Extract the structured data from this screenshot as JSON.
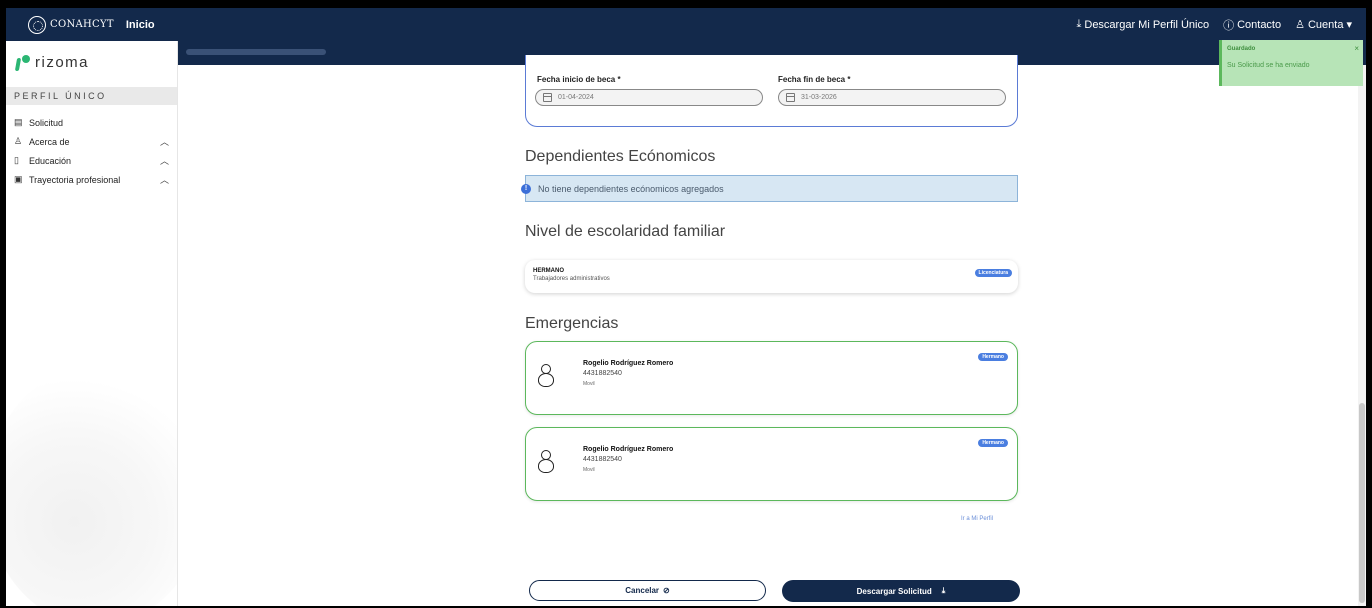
{
  "topbar": {
    "brand": "CONAHCYT",
    "brand_sub": "",
    "home": "Inicio",
    "download_profile": "Descargar Mi Perfil Único",
    "contact": "Contacto",
    "account": "Cuenta",
    "icons": [
      "download-icon",
      "help-circle-icon",
      "user-icon",
      "caret-down-icon"
    ]
  },
  "sidebar": {
    "logo": "rizoma",
    "section_title": "PERFIL ÚNICO",
    "items": [
      {
        "label": "Solicitud",
        "icon": "document-icon",
        "expandable": false
      },
      {
        "label": "Acerca de",
        "icon": "user-icon",
        "expandable": true
      },
      {
        "label": "Educación",
        "icon": "book-icon",
        "expandable": true
      },
      {
        "label": "Trayectoria profesional",
        "icon": "id-card-icon",
        "expandable": true
      }
    ]
  },
  "beca": {
    "start_label": "Fecha inicio de beca *",
    "start_value": "01-04-2024",
    "end_label": "Fecha fin de beca *",
    "end_value": "31-03-2026"
  },
  "dependientes": {
    "title": "Dependientes Ecónomicos",
    "alert": "No tiene dependientes ecónomicos agregados"
  },
  "escolaridad": {
    "title": "Nivel de escolaridad familiar",
    "relation": "HERMANO",
    "occupation": "Trabajadores administrativos",
    "level": "Licenciatura"
  },
  "emergencias": {
    "title": "Emergencias",
    "contacts": [
      {
        "name": "Rogelio Rodríguez Romero",
        "phone": "4431882540",
        "type": "Movil",
        "relation": "Hermano"
      },
      {
        "name": "Rogelio Rodríguez Romero",
        "phone": "4431882540",
        "type": "Movil",
        "relation": "Hermano"
      }
    ],
    "profile_link": "Ir a Mi Perfil"
  },
  "actions": {
    "cancel": "Cancelar",
    "download": "Descargar Solicitud"
  },
  "toast": {
    "title": "Guardado",
    "message": "Su Solicitud se ha enviado",
    "color": "#b7e4b7"
  },
  "colors": {
    "navy": "#13294b",
    "accent_blue": "#5b7bd5",
    "success_green": "#5cb85c",
    "brand_green": "#2bb673"
  }
}
